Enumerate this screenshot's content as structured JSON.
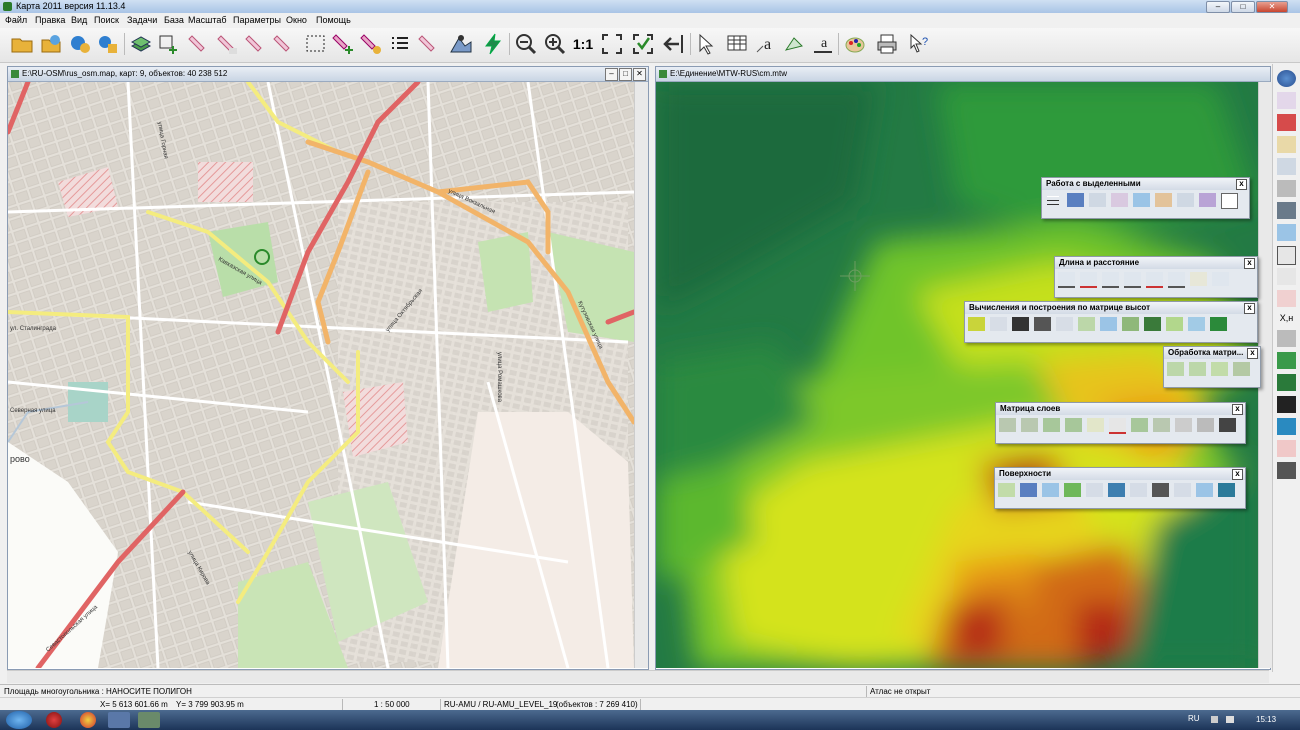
{
  "window": {
    "title": "Карта 2011 версия 11.13.4",
    "minimize": "–",
    "maximize": "□",
    "close": "✕"
  },
  "menu": [
    "Файл",
    "Правка",
    "Вид",
    "Поиск",
    "Задачи",
    "База",
    "Масштаб",
    "Параметры",
    "Окно",
    "Помощь"
  ],
  "toolbar": {
    "scale_label": "1:1",
    "icons": [
      "open-folder",
      "open-map",
      "open-globe",
      "open-layers",
      "edit-map",
      "add-object",
      "tool-1",
      "tool-2",
      "tool-3",
      "tool-4",
      "select-rect",
      "add-point",
      "cut-object",
      "list",
      "tool-5",
      "spatial-analysis",
      "lightning",
      "zoom-out",
      "zoom-in",
      "zoom-1-1",
      "zoom-fit",
      "check-mark",
      "back-arrow",
      "pointer",
      "table",
      "text-a",
      "rotate",
      "text-b",
      "palette",
      "print",
      "help"
    ]
  },
  "left_window": {
    "title": "E:\\RU-OSM\\rus_osm.map, карт: 9, объектов: 40 238 512",
    "labels": [
      "Северная улица",
      "ул. Сталинграда",
      "рово",
      "Севастопольская улица",
      "Кавказская улица",
      "улица Вокзальная",
      "улица Горная",
      "улица Октябрьская",
      "Кутузовская улица",
      "улица Ромашкова",
      "улица Кирова"
    ]
  },
  "right_window": {
    "title": "E:\\Единение\\MTW-RUS\\cm.mtw"
  },
  "panels": [
    {
      "title": "Работа с выделенными",
      "icon_count": 11
    },
    {
      "title": "Длина и расстояние",
      "icon_count": 9
    },
    {
      "title": "Вычисления и построения по матрице высот",
      "icon_count": 13
    },
    {
      "title": "Обработка матри...",
      "icon_count": 4
    },
    {
      "title": "Матрица слоев",
      "icon_count": 11
    },
    {
      "title": "Поверхности",
      "icon_count": 11
    }
  ],
  "right_toolbar": {
    "xyh_label": "X,н"
  },
  "status": {
    "polygon_area": "Площадь многоугольника : НАНОСИТЕ ПОЛИГОН",
    "atlas": "Атлас не открыт",
    "x": "X= 5 613 601.66 m",
    "y": "Y= 3 799 903.95 m",
    "scale": "1 : 50 000",
    "layer": "RU-AMU / RU-AMU_LEVEL_19",
    "objects": "(объектов : 7 269 410)"
  },
  "taskbar": {
    "lang": "RU",
    "time": "15:13"
  },
  "colors": {
    "map_bg": "#efe9dd",
    "road_orange": "#f3b46b",
    "road_red": "#e06464",
    "road_yellow": "#f7f38f",
    "relief_low": "#1f7a44",
    "relief_high": "#b21e0c"
  }
}
